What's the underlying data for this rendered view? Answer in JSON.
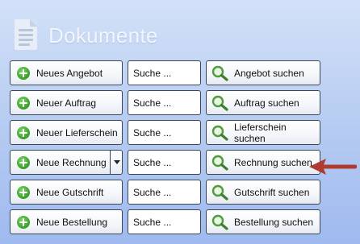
{
  "header": {
    "title": "Dokumente"
  },
  "rows": [
    {
      "new_label": "Neues Angebot",
      "search_placeholder": "Suche ...",
      "find_label": "Angebot suchen"
    },
    {
      "new_label": "Neuer Auftrag",
      "search_placeholder": "Suche ...",
      "find_label": "Auftrag suchen"
    },
    {
      "new_label": "Neuer Lieferschein",
      "search_placeholder": "Suche ...",
      "find_label": "Lieferschein suchen"
    },
    {
      "new_label": "Neue Rechnung",
      "search_placeholder": "Suche ...",
      "find_label": "Rechnung suchen",
      "has_dropdown": true
    },
    {
      "new_label": "Neue Gutschrift",
      "search_placeholder": "Suche ...",
      "find_label": "Gutschrift suchen"
    },
    {
      "new_label": "Neue Bestellung",
      "search_placeholder": "Suche ...",
      "find_label": "Bestellung suchen"
    }
  ],
  "icons": {
    "header": "document-icon",
    "new": "plus-circle-icon",
    "find": "magnifier-icon",
    "pointer": "arrow-left-icon"
  },
  "colors": {
    "plus_green": "#3ea52b",
    "magnifier_green": "#4f9c3a",
    "arrow_red": "#b03a2e"
  }
}
